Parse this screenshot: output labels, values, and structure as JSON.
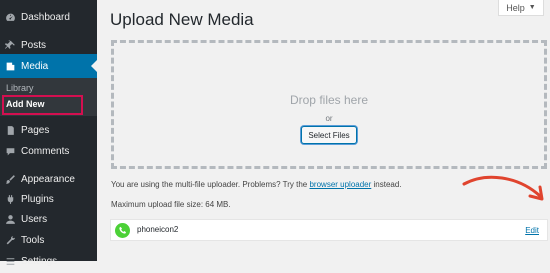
{
  "sidebar": {
    "items": [
      {
        "label": "Dashboard",
        "icon": "dashboard-icon"
      },
      {
        "label": "Posts",
        "icon": "pin-icon"
      },
      {
        "label": "Media",
        "icon": "media-icon",
        "active": true
      },
      {
        "label": "Pages",
        "icon": "pages-icon"
      },
      {
        "label": "Comments",
        "icon": "comments-icon"
      },
      {
        "label": "Appearance",
        "icon": "paintbrush-icon"
      },
      {
        "label": "Plugins",
        "icon": "plug-icon"
      },
      {
        "label": "Users",
        "icon": "user-icon"
      },
      {
        "label": "Tools",
        "icon": "wrench-icon"
      },
      {
        "label": "Settings",
        "icon": "settings-icon"
      }
    ],
    "submenu": {
      "library": "Library",
      "add_new": "Add New"
    },
    "colors": {
      "background": "#23282d",
      "active": "#0073aa",
      "highlight": "#d40f50"
    }
  },
  "header": {
    "title": "Upload New Media",
    "help_label": "Help",
    "help_arrow": "▼"
  },
  "dropzone": {
    "drop_text": "Drop files here",
    "or_text": "or",
    "select_button": "Select Files"
  },
  "info": {
    "uploader_text_pre": "You are using the multi-file uploader. Problems? Try the ",
    "uploader_link": "browser uploader",
    "uploader_text_post": " instead.",
    "max_size": "Maximum upload file size: 64 MB."
  },
  "upload_item": {
    "file_name": "phoneicon2",
    "edit_label": "Edit",
    "icon": "phone-icon"
  }
}
